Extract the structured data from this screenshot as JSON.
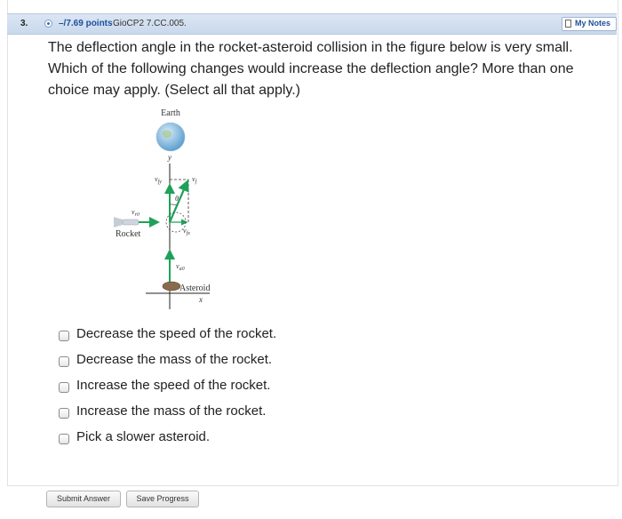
{
  "question": {
    "number": "3.",
    "points": "–/7.69 points",
    "code": "GioCP2 7.CC.005.",
    "my_notes": "My Notes",
    "text": "The deflection angle in the rocket-asteroid collision in the figure below is very small. Which of the following changes would increase the deflection angle? More than one choice may apply. (Select all that apply.)"
  },
  "figure": {
    "earth_label": "Earth",
    "y_axis": "y",
    "x_axis": "x",
    "rocket_label": "Rocket",
    "asteroid_label": "Asteroid",
    "angle_label": "θ",
    "v_fy": "v",
    "v_fy_sub": "fy",
    "v_f": "v",
    "v_f_sub": "f",
    "v_r0": "v",
    "v_r0_sub": "r0",
    "v_fx": "v",
    "v_fx_sub": "fx",
    "v_a0": "v",
    "v_a0_sub": "a0",
    "colors": {
      "vector": "#1fa15a",
      "earth": "#8cc0e6",
      "asteroid": "#8a6a4c"
    }
  },
  "choices": [
    {
      "label": "Decrease the speed of the rocket.",
      "checked": false
    },
    {
      "label": "Decrease the mass of the rocket.",
      "checked": false
    },
    {
      "label": "Increase the speed of the rocket.",
      "checked": false
    },
    {
      "label": "Increase the mass of the rocket.",
      "checked": false
    },
    {
      "label": "Pick a slower asteroid.",
      "checked": false
    }
  ],
  "buttons": {
    "submit": "Submit Answer",
    "save": "Save Progress"
  }
}
